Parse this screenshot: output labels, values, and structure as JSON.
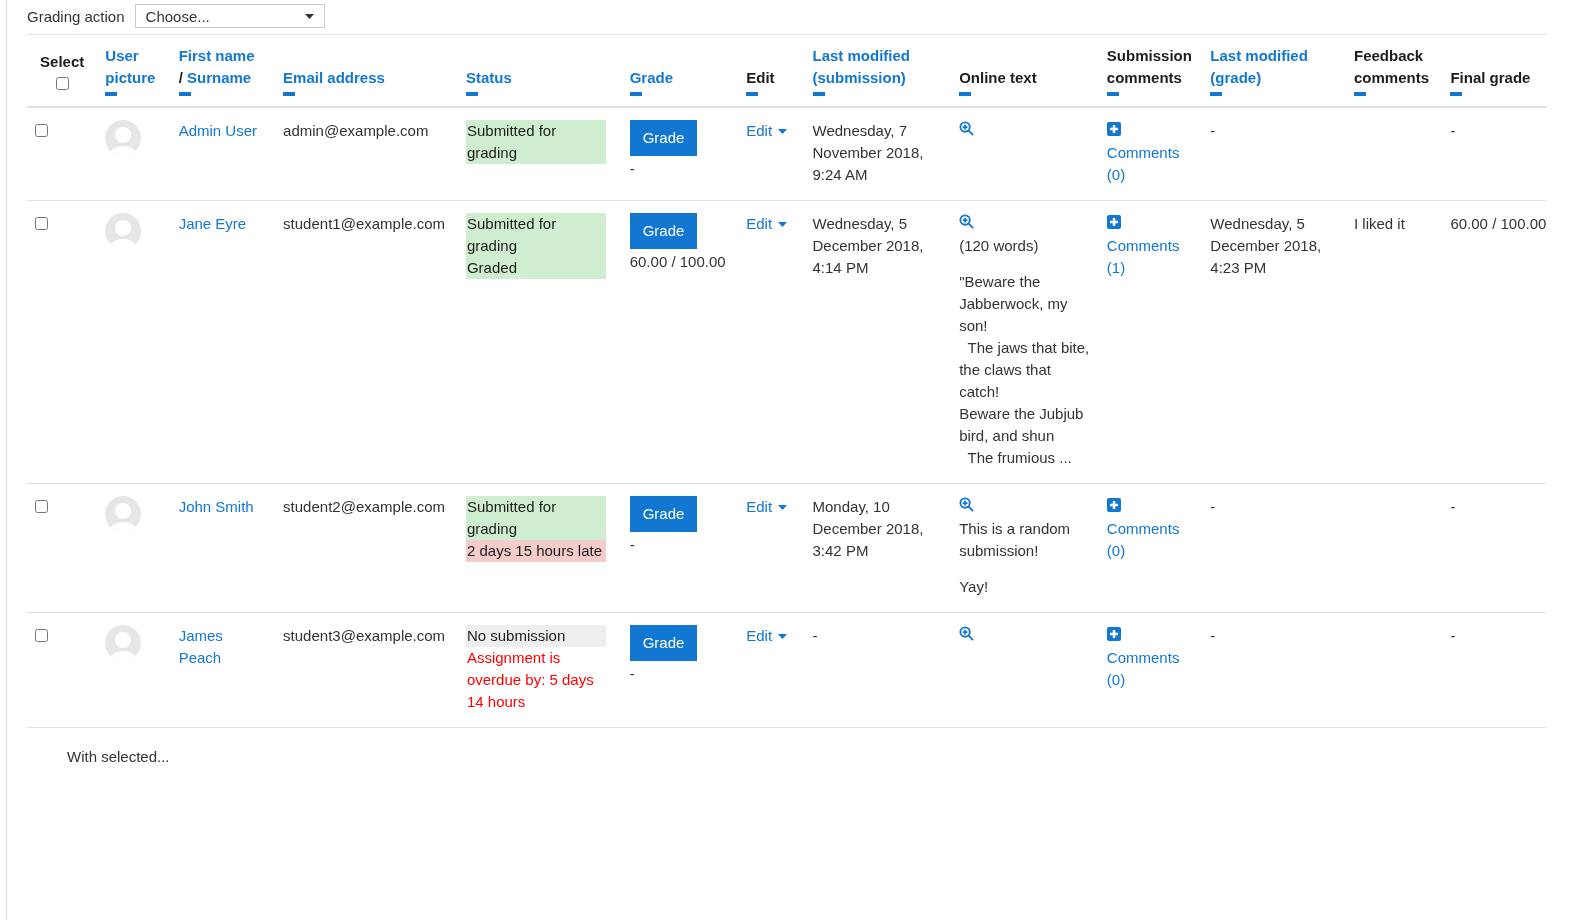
{
  "grading_action": {
    "label": "Grading action",
    "select_value": "Choose..."
  },
  "select_all_checked": false,
  "columns": [
    {
      "label": "Select",
      "link": false,
      "kind": "select"
    },
    {
      "label": "User picture",
      "link": true,
      "kind": "text"
    },
    {
      "label": "First name",
      "separator": "/",
      "label2": "Surname",
      "link": true,
      "kind": "name"
    },
    {
      "label": "Email address",
      "link": true,
      "kind": "text"
    },
    {
      "label": "Status",
      "link": true,
      "kind": "text"
    },
    {
      "label": "Grade",
      "link": true,
      "kind": "text"
    },
    {
      "label": "Edit",
      "link": false,
      "kind": "text"
    },
    {
      "label": "Last modified (submission)",
      "link": true,
      "kind": "text"
    },
    {
      "label": "Online text",
      "link": false,
      "kind": "text"
    },
    {
      "label": "Submission comments",
      "link": false,
      "kind": "text"
    },
    {
      "label": "Last modified (grade)",
      "link": true,
      "kind": "text"
    },
    {
      "label": "Feedback comments",
      "link": false,
      "kind": "text"
    },
    {
      "label": "Final grade",
      "link": false,
      "kind": "text"
    }
  ],
  "rows": [
    {
      "checked": false,
      "name": "Admin User",
      "email": "admin@example.com",
      "status": [
        {
          "kind": "submitted",
          "text": "Submitted for grading"
        }
      ],
      "grade_button": "Grade",
      "grade": "-",
      "edit": "Edit",
      "modified": "Wednesday, 7 November 2018, 9:24 AM",
      "online_text": [],
      "comments": "Comments (0)",
      "modified_grade": "-",
      "feedback": "",
      "final_grade": "-"
    },
    {
      "checked": false,
      "name": "Jane Eyre",
      "email": "student1@example.com",
      "status": [
        {
          "kind": "submitted",
          "text": "Submitted for grading"
        },
        {
          "kind": "graded",
          "text": "Graded"
        }
      ],
      "grade_button": "Grade",
      "grade": "60.00 / 100.00",
      "edit": "Edit",
      "modified": "Wednesday, 5 December 2018, 4:14 PM",
      "online_text": [
        "(120 words)",
        "\"Beware the Jabberwock, my son!\n  The jaws that bite, the claws that catch!\nBeware the Jubjub bird, and shun\n  The frumious ..."
      ],
      "comments": "Comments (1)",
      "modified_grade": "Wednesday, 5 December 2018, 4:23 PM",
      "feedback": "I liked it",
      "final_grade": "60.00 / 100.00"
    },
    {
      "checked": false,
      "name": "John Smith",
      "email": "student2@example.com",
      "status": [
        {
          "kind": "submitted",
          "text": "Submitted for grading"
        },
        {
          "kind": "late",
          "text": "2 days 15 hours late"
        }
      ],
      "grade_button": "Grade",
      "grade": "-",
      "edit": "Edit",
      "modified": "Monday, 10 December 2018, 3:42 PM",
      "online_text": [
        "This is a random submission!",
        "Yay!"
      ],
      "comments": "Comments (0)",
      "modified_grade": "-",
      "feedback": "",
      "final_grade": "-"
    },
    {
      "checked": false,
      "name": "James Peach",
      "email": "student3@example.com",
      "status": [
        {
          "kind": "nosubmission",
          "text": "No submission"
        },
        {
          "kind": "overdue",
          "text": "Assignment is overdue by: 5 days 14 hours"
        }
      ],
      "grade_button": "Grade",
      "grade": "-",
      "edit": "Edit",
      "modified": "-",
      "online_text": [],
      "comments": "Comments (0)",
      "modified_grade": "-",
      "feedback": "",
      "final_grade": "-"
    }
  ],
  "footer": {
    "label": "With selected..."
  }
}
